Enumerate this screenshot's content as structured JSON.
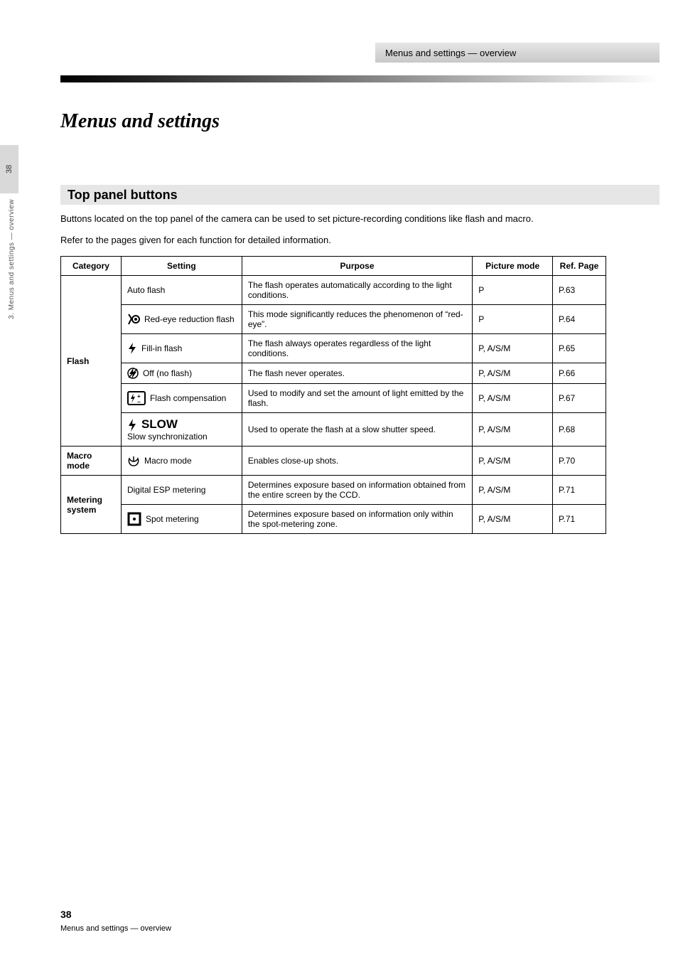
{
  "header_tab": "Menus and settings — overview",
  "page_num_tab": "38",
  "side_running": "3. Menus and settings — overview",
  "page_title": "Menus and settings",
  "section_title": "Top panel buttons",
  "section_note": "Buttons located on the top panel of the camera can be used to set picture-recording conditions like flash and macro.",
  "section_help": "Refer to the pages given for each function for detailed information.",
  "table": {
    "head": {
      "category": "Category",
      "setting": "Setting",
      "purpose": "Purpose",
      "mode": "Picture mode",
      "page": "Ref. Page"
    },
    "rows": [
      {
        "category": "Flash",
        "setting": "Auto flash",
        "purpose": "The flash operates automatically according to the light conditions.",
        "mode": "P",
        "page": "P.63"
      },
      {
        "category": "",
        "icon": "redeye",
        "setting": "Red-eye reduction flash",
        "purpose": "This mode significantly reduces the phenomenon of “red-eye”.",
        "mode": "P",
        "page": "P.64"
      },
      {
        "category": "",
        "icon": "fill",
        "setting": "Fill-in flash",
        "purpose": "The flash always operates regardless of the light conditions.",
        "mode": "P, A/S/M",
        "page": "P.65"
      },
      {
        "category": "",
        "icon": "off",
        "setting": "Off (no flash)",
        "purpose": "The flash never operates.",
        "mode": "P, A/S/M",
        "page": "P.66"
      },
      {
        "category": "",
        "icon": "comp",
        "setting": "Flash compensation",
        "purpose": "Used to modify and set the amount of light emitted by the flash.",
        "mode": "P, A/S/M",
        "page": "P.67"
      },
      {
        "category": "",
        "icon": "slow",
        "label": "SLOW",
        "setting": "Slow synchronization",
        "purpose": "Used to operate the flash at a slow shutter speed.",
        "mode": "P, A/S/M",
        "page": "P.68"
      },
      {
        "category": "Macro mode",
        "icon": "macro",
        "setting": "Macro mode",
        "purpose": "Enables close-up shots.",
        "mode": "P, A/S/M",
        "page": "P.70"
      },
      {
        "category": "Metering system",
        "setting": "Digital ESP metering",
        "purpose": "Determines exposure based on information obtained from the entire screen by the CCD.",
        "mode": "P, A/S/M",
        "page": "P.71"
      },
      {
        "category": "",
        "icon": "spot",
        "setting": "Spot metering",
        "purpose": "Determines exposure based on information only within the spot-metering zone.",
        "mode": "P, A/S/M",
        "page": "P.71"
      }
    ]
  },
  "footer_page": "38",
  "footer_sub": "Menus and settings — overview"
}
